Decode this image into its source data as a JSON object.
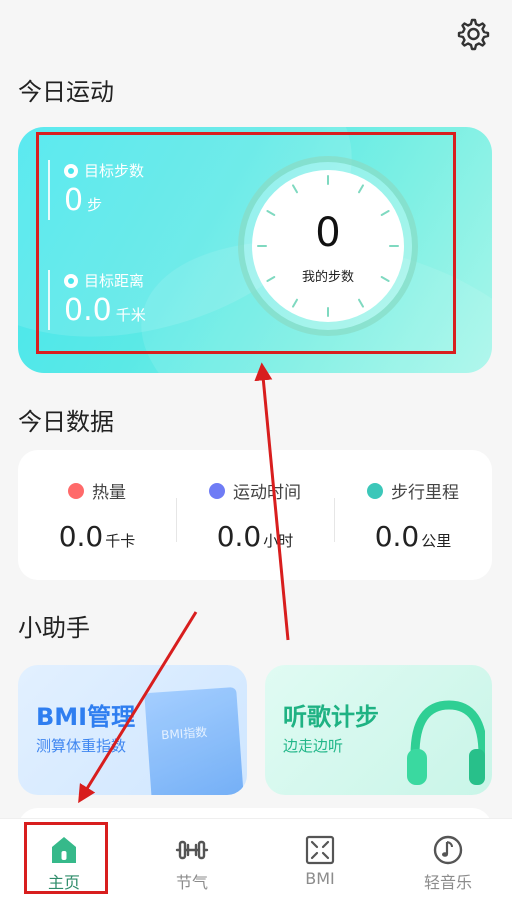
{
  "header": {
    "settings_icon": "gear-icon"
  },
  "sections": {
    "today_sport": "今日运动",
    "today_data": "今日数据",
    "assistant": "小助手"
  },
  "sport_card": {
    "goal_steps_label": "目标步数",
    "goal_steps_value": "0",
    "goal_steps_unit": "步",
    "goal_distance_label": "目标距离",
    "goal_distance_value": "0.0",
    "goal_distance_unit": "千米",
    "step_count": "0",
    "step_count_label": "我的步数"
  },
  "today_data": [
    {
      "label": "热量",
      "value": "0.0",
      "unit": "千卡",
      "icon": "flame-icon",
      "color": "#ff6a6a"
    },
    {
      "label": "运动时间",
      "value": "0.0",
      "unit": "小时",
      "icon": "clock-icon",
      "color": "#6f7cf5"
    },
    {
      "label": "步行里程",
      "value": "0.0",
      "unit": "公里",
      "icon": "location-icon",
      "color": "#3cc7b9"
    }
  ],
  "helpers": {
    "bmi": {
      "title": "BMI管理",
      "subtitle": "测算体重指数",
      "book_text": "BMI指数"
    },
    "music": {
      "title": "听歌计步",
      "subtitle": "边走边听"
    }
  },
  "tabs": [
    {
      "label": "主页",
      "icon": "home-icon",
      "active": true
    },
    {
      "label": "节气",
      "icon": "dumbbell-icon",
      "active": false
    },
    {
      "label": "BMI",
      "icon": "bmi-icon",
      "active": false
    },
    {
      "label": "轻音乐",
      "icon": "music-disc-icon",
      "active": false
    }
  ],
  "colors": {
    "accent": "#45e6ee",
    "annotation_red": "#d81e1e",
    "active_tab": "#2e8c6a"
  }
}
